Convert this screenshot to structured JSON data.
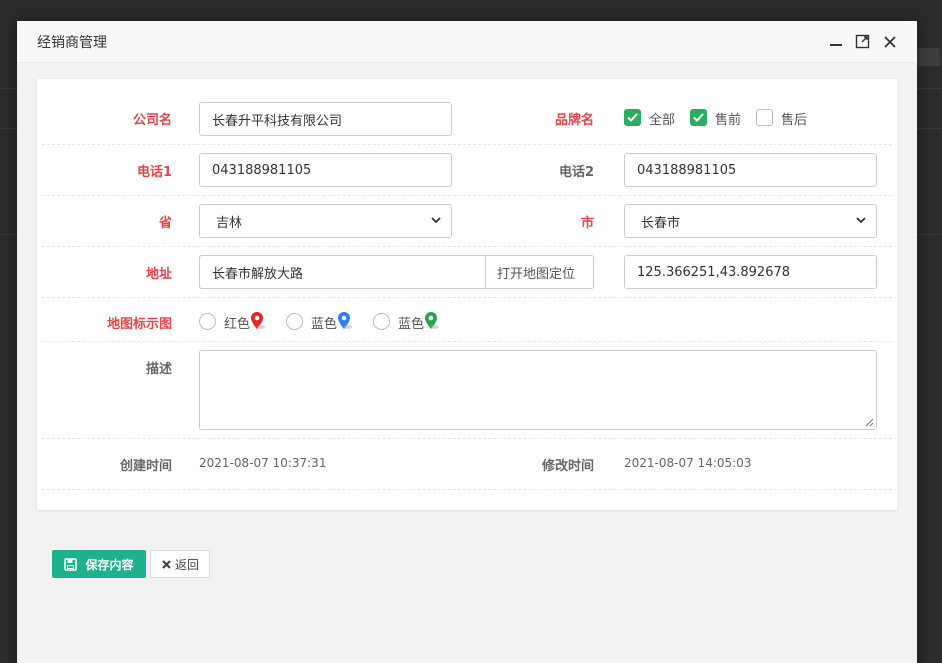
{
  "modal": {
    "title": "经销商管理"
  },
  "form": {
    "company": {
      "label": "公司名",
      "value": "长春升平科技有限公司"
    },
    "brand": {
      "label": "品牌名",
      "options": [
        {
          "label": "全部",
          "checked": true
        },
        {
          "label": "售前",
          "checked": true
        },
        {
          "label": "售后",
          "checked": false
        }
      ]
    },
    "phone1": {
      "label": "电话1",
      "value": "043188981105"
    },
    "phone2": {
      "label": "电话2",
      "value": "043188981105"
    },
    "province": {
      "label": "省",
      "value": "吉林"
    },
    "city": {
      "label": "市",
      "value": "长春市"
    },
    "address": {
      "label": "地址",
      "value": "长春市解放大路",
      "map_button": "打开地图定位",
      "coords": "125.366251,43.892678"
    },
    "map_marker": {
      "label": "地图标示图",
      "options": [
        {
          "label": "红色",
          "color": "#e5262c"
        },
        {
          "label": "蓝色",
          "color": "#2f80e6"
        },
        {
          "label": "蓝色",
          "color": "#2aa44a"
        }
      ]
    },
    "description": {
      "label": "描述",
      "value": ""
    },
    "created": {
      "label": "创建时间",
      "value": "2021-08-07 10:37:31"
    },
    "modified": {
      "label": "修改时间",
      "value": "2021-08-07 14:05:03"
    }
  },
  "actions": {
    "save": "保存内容",
    "back": "返回"
  },
  "colors": {
    "accent": "#1fb08d",
    "required": "#e0474c",
    "check": "#2cab62"
  }
}
